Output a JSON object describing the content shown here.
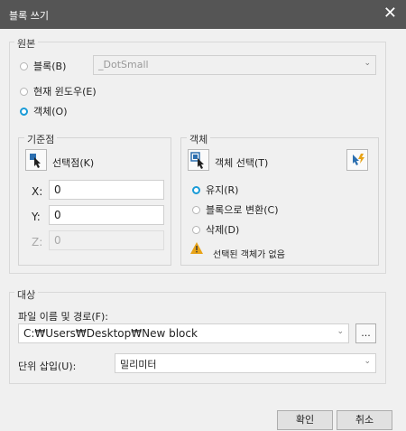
{
  "window": {
    "title": "블록 쓰기",
    "close_icon": "✕"
  },
  "source": {
    "legend": "원본",
    "options": [
      {
        "label": "블록(B)"
      },
      {
        "label": "현재 윈도우(E)"
      },
      {
        "label": "객체(O)"
      }
    ],
    "selected_index": 2,
    "block_select": {
      "value": "_DotSmall"
    }
  },
  "basepoint": {
    "legend": "기준점",
    "pick_label": "선택점(K)",
    "x_label": "X:",
    "x_value": "0",
    "y_label": "Y:",
    "y_value": "0",
    "z_label": "Z:",
    "z_value": "0"
  },
  "objects": {
    "legend": "객체",
    "select_label": "객체 선택(T)",
    "options": [
      {
        "label": "유지(R)"
      },
      {
        "label": "블록으로 변환(C)"
      },
      {
        "label": "삭제(D)"
      }
    ],
    "selected_index": 0,
    "warning_text": "선택된 객체가 없음"
  },
  "destination": {
    "legend": "대상",
    "path_label": "파일 이름 및 경로(F):",
    "path_value": "C:₩Users₩Desktop₩New block",
    "browse_label": "...",
    "units_label": "단위 삽입(U):",
    "units_value": "밀리미터"
  },
  "buttons": {
    "ok": "확인",
    "cancel": "취소"
  },
  "colors": {
    "titlebar": "#555555",
    "accent": "#1a9bd7",
    "warning": "#e8a317"
  }
}
